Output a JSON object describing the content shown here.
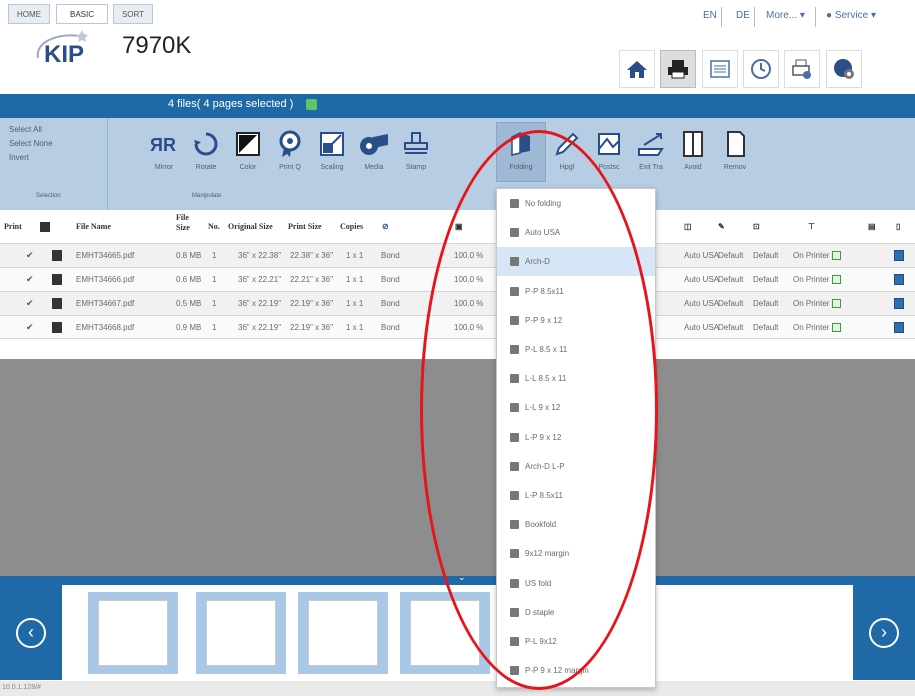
{
  "app": {
    "brand": "KIP",
    "model": "7970K"
  },
  "lang_bar": {
    "en": "EN",
    "de": "DE",
    "more": "More... ▾",
    "service": "Service ▾"
  },
  "tabs": [
    {
      "label": "HOME"
    },
    {
      "label": "BASIC"
    },
    {
      "label": "SORT"
    }
  ],
  "files_selected": "4 files( 4 pages selected )",
  "selection": {
    "select_all": "Select All",
    "select_none": "Select None",
    "invert": "Invert",
    "group_label": "Selection",
    "manipulate_label": "Manipulate"
  },
  "toolbar": [
    {
      "label": "Mirror",
      "icon": "mirror-icon"
    },
    {
      "label": "Rotate",
      "icon": "rotate-icon"
    },
    {
      "label": "Color",
      "icon": "color-icon"
    },
    {
      "label": "Print Q",
      "icon": "print-quality-icon"
    },
    {
      "label": "Scaling",
      "icon": "scaling-icon"
    },
    {
      "label": "Media",
      "icon": "media-icon"
    },
    {
      "label": "Stamp",
      "icon": "stamp-icon"
    },
    {
      "label": "Folding",
      "icon": "folding-icon"
    },
    {
      "label": "Hpgl",
      "icon": "pencil-icon"
    },
    {
      "label": "Postsc",
      "icon": "postscript-icon"
    },
    {
      "label": "Exit Tra",
      "icon": "exit-tray-icon"
    },
    {
      "label": "Avoid",
      "icon": "avoid-icon"
    },
    {
      "label": "Remov",
      "icon": "remove-icon"
    }
  ],
  "table": {
    "headers": {
      "print": "Print",
      "file_name": "File Name",
      "file_size": "File Size",
      "no": "No.",
      "original_size": "Original Size",
      "print_size": "Print Size",
      "copies": "Copies"
    },
    "rows": [
      {
        "file": "EMHT34665.pdf",
        "size": "0.8 MB",
        "no": "1",
        "orig": "36\" x 22.38\"",
        "print": "22.38\" x 36\"",
        "copies": "1 x 1",
        "media": "Bond",
        "scale": "100.0 %",
        "fold": "Auto USA",
        "hpgl": "Default",
        "ps": "Default",
        "tray": "On Printer"
      },
      {
        "file": "EMHT34666.pdf",
        "size": "0.6 MB",
        "no": "1",
        "orig": "36\" x 22.21\"",
        "print": "22.21\" x 36\"",
        "copies": "1 x 1",
        "media": "Bond",
        "scale": "100.0 %",
        "fold": "Auto USA",
        "hpgl": "Default",
        "ps": "Default",
        "tray": "On Printer"
      },
      {
        "file": "EMHT34667.pdf",
        "size": "0.5 MB",
        "no": "1",
        "orig": "36\" x 22.19\"",
        "print": "22.19\" x 36\"",
        "copies": "1 x 1",
        "media": "Bond",
        "scale": "100.0 %",
        "fold": "Auto USA",
        "hpgl": "Default",
        "ps": "Default",
        "tray": "On Printer"
      },
      {
        "file": "EMHT34668.pdf",
        "size": "0.9 MB",
        "no": "1",
        "orig": "36\" x 22.19\"",
        "print": "22.19\" x 36\"",
        "copies": "1 x 1",
        "media": "Bond",
        "scale": "100.0 %",
        "fold": "Auto USA",
        "hpgl": "Default",
        "ps": "Default",
        "tray": "On Printer"
      }
    ]
  },
  "folding_menu": {
    "selected": "Arch-D",
    "items": [
      "No folding",
      "Auto USA",
      "Arch-D",
      "P-P 8.5x11",
      "P-P 9 x 12",
      "P-L 8.5 x 11",
      "L-L 8.5 x 11",
      "L-L 9 x 12",
      "L-P 9 x 12",
      "Arch-D L-P",
      "L-P 8.5x11",
      "Bookfold",
      "9x12 margin",
      "US fold",
      "D staple",
      "P-L 9x12",
      "P-P 9 x 12 margin"
    ]
  },
  "status_bar": "10.0.1.128/#",
  "colors": {
    "brand_blue": "#1f6aa6",
    "ribbon": "#b7cde3",
    "highlight_ellipse": "#e8141b"
  }
}
